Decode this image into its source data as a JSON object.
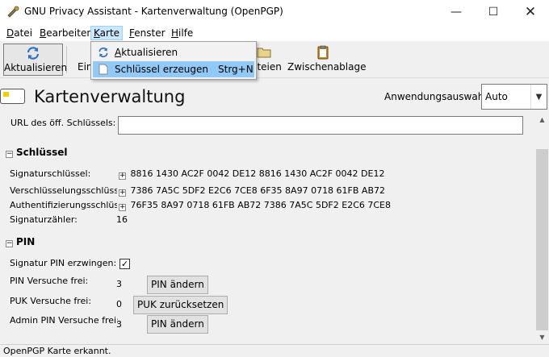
{
  "window": {
    "title": "GNU Privacy Assistant - Kartenverwaltung (OpenPGP)",
    "minimize": "—",
    "maximize": "☐",
    "close": "✕"
  },
  "menu": {
    "items": [
      {
        "mnemonic": "D",
        "rest": "atei"
      },
      {
        "mnemonic": "B",
        "rest": "earbeiten"
      },
      {
        "mnemonic": "K",
        "rest": "arte"
      },
      {
        "mnemonic": "F",
        "rest": "enster"
      },
      {
        "mnemonic": "H",
        "rest": "ilfe"
      }
    ],
    "active": "Karte"
  },
  "dropdown": {
    "items": [
      {
        "mnemonic": "A",
        "rest": "ktualisieren",
        "shortcut": "",
        "icon": "refresh-icon"
      },
      {
        "mnemonic": "",
        "rest": "Schlüssel erzeugen",
        "shortcut": "Strg+N",
        "icon": "document-icon"
      }
    ]
  },
  "toolbar": {
    "refresh_label": "Aktualisieren",
    "settings_partial": "Ein",
    "files_partial": "ateien",
    "clipboard_label": "Zwischenablage"
  },
  "header": {
    "title": "Kartenverwaltung",
    "app_select_label": "Anwendungsauswahl:",
    "app_select_value": "Auto",
    "app_select_arrow": "▼"
  },
  "form": {
    "url_label": "URL des öff. Schlüssels:",
    "url_value": "",
    "keys_section": "Schlüssel",
    "sig_key_label": "Signaturschlüssel:",
    "sig_key_value": "8816 1430 AC2F 0042 DE12  8816 1430 AC2F 0042 DE12",
    "enc_key_label": "Verschlüsselungsschlüssel:",
    "enc_key_value": "7386 7A5C 5DF2 E2C6 7CE8  6F35 8A97 0718 61FB AB72",
    "auth_key_label": "Authentifizierungsschlüssel:",
    "auth_key_value": "76F35 8A97 0718 61FB AB72  7386 7A5C 5DF2 E2C6 7CE8",
    "sig_counter_label": "Signaturzähler:",
    "sig_counter_value": "16",
    "pin_section": "PIN",
    "force_pin_label": "Signatur PIN erzwingen:",
    "force_pin_checked": "✓",
    "pin_tries_label": "PIN Versuche frei:",
    "pin_tries_value": "3",
    "pin_change_button": "PIN ändern",
    "puk_tries_label": "PUK Versuche frei:",
    "puk_tries_value": "0",
    "puk_reset_button": "PUK zurücksetzen",
    "admin_pin_tries_label": "Admin PIN Versuche frei:",
    "admin_pin_tries_value": "3",
    "admin_pin_change_button": "PIN ändern",
    "expander_collapse": "−",
    "expander_expand": "+"
  },
  "scroll": {
    "up": "▲",
    "down": "▼"
  },
  "status": {
    "text": "OpenPGP Karte erkannt."
  }
}
